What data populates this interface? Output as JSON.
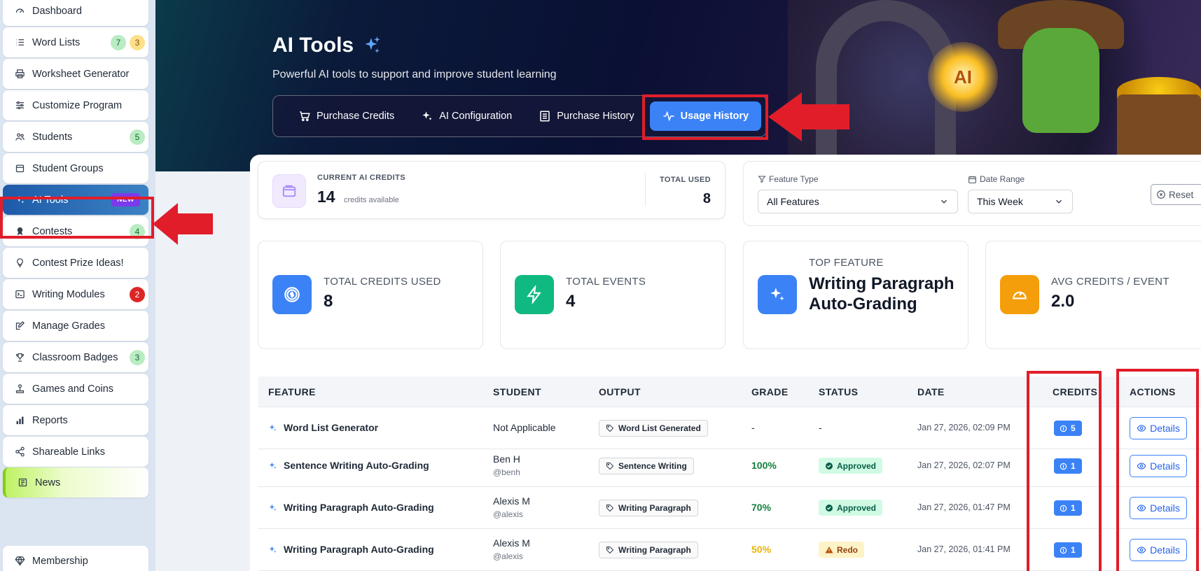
{
  "sidebar": {
    "items": [
      {
        "label": "Dashboard",
        "icon": "dashboard-icon"
      },
      {
        "label": "Word Lists",
        "icon": "list-icon",
        "badges": [
          "7",
          "3"
        ]
      },
      {
        "label": "Worksheet Generator",
        "icon": "printer-icon"
      },
      {
        "label": "Customize Program",
        "icon": "sliders-icon"
      },
      {
        "label": "Students",
        "icon": "users-icon",
        "badges": [
          "5"
        ]
      },
      {
        "label": "Student Groups",
        "icon": "folder-icon"
      },
      {
        "label": "AI Tools",
        "icon": "sparkles-icon",
        "tag": "NEW"
      },
      {
        "label": "Contests",
        "icon": "award-icon",
        "badges": [
          "4"
        ]
      },
      {
        "label": "Contest Prize Ideas!",
        "icon": "lightbulb-icon"
      },
      {
        "label": "Writing Modules",
        "icon": "terminal-icon",
        "badges": [
          "2"
        ]
      },
      {
        "label": "Manage Grades",
        "icon": "edit-icon"
      },
      {
        "label": "Classroom Badges",
        "icon": "trophy-icon",
        "badges": [
          "3"
        ]
      },
      {
        "label": "Games and Coins",
        "icon": "joystick-icon"
      },
      {
        "label": "Reports",
        "icon": "bar-chart-icon"
      },
      {
        "label": "Shareable Links",
        "icon": "share-icon"
      },
      {
        "label": "News",
        "icon": "newspaper-icon"
      },
      {
        "label": "Membership",
        "icon": "gem-icon"
      }
    ]
  },
  "hero": {
    "title": "AI Tools",
    "subtitle": "Powerful AI tools to support and improve student learning",
    "tabs": [
      {
        "label": "Purchase Credits",
        "icon": "cart-icon"
      },
      {
        "label": "AI Configuration",
        "icon": "sparkles-icon"
      },
      {
        "label": "Purchase History",
        "icon": "receipt-icon"
      },
      {
        "label": "Usage History",
        "icon": "activity-icon",
        "active": true
      }
    ],
    "art_text": "AI"
  },
  "credits": {
    "label": "CURRENT AI CREDITS",
    "value": "14",
    "unit": "credits available",
    "total_used_label": "TOTAL USED",
    "total_used_value": "8"
  },
  "filters": {
    "feature_type_label": "Feature Type",
    "feature_type_value": "All Features",
    "date_range_label": "Date Range",
    "date_range_value": "This Week",
    "reset_label": "Reset"
  },
  "stats": [
    {
      "label": "TOTAL CREDITS USED",
      "value": "8",
      "icon": "dollar-coin-icon",
      "color": "#3b82f6"
    },
    {
      "label": "TOTAL EVENTS",
      "value": "4",
      "icon": "lightning-icon",
      "color": "#10b981"
    },
    {
      "label": "TOP FEATURE",
      "value": "Writing Paragraph Auto-Grading",
      "icon": "sparkles-icon",
      "color": "#3b82f6"
    },
    {
      "label": "AVG CREDITS / EVENT",
      "value": "2.0",
      "icon": "gauge-icon",
      "color": "#f59e0b"
    }
  ],
  "table": {
    "headers": [
      "FEATURE",
      "STUDENT",
      "OUTPUT",
      "GRADE",
      "STATUS",
      "DATE",
      "CREDITS",
      "ACTIONS"
    ],
    "rows": [
      {
        "feature": "Word List Generator",
        "student": "Not Applicable",
        "handle": "",
        "output": "Word List Generated",
        "grade": "-",
        "status": "-",
        "date": "Jan 27, 2026, 02:09 PM",
        "credits": "5",
        "action": "Details"
      },
      {
        "feature": "Sentence Writing Auto-Grading",
        "student": "Ben H",
        "handle": "@benh",
        "output": "Sentence Writing",
        "grade": "100%",
        "status": "Approved",
        "date": "Jan 27, 2026, 02:07 PM",
        "credits": "1",
        "action": "Details"
      },
      {
        "feature": "Writing Paragraph Auto-Grading",
        "student": "Alexis M",
        "handle": "@alexis",
        "output": "Writing Paragraph",
        "grade": "70%",
        "status": "Approved",
        "date": "Jan 27, 2026, 01:47 PM",
        "credits": "1",
        "action": "Details"
      },
      {
        "feature": "Writing Paragraph Auto-Grading",
        "student": "Alexis M",
        "handle": "@alexis",
        "output": "Writing Paragraph",
        "grade": "50%",
        "status": "Redo",
        "date": "Jan 27, 2026, 01:41 PM",
        "credits": "1",
        "action": "Details"
      }
    ]
  },
  "colors": {
    "accent": "#3b82f6",
    "annotation_red": "#e11d2a",
    "grade_good": "#15803d",
    "grade_warn": "#eab308"
  }
}
